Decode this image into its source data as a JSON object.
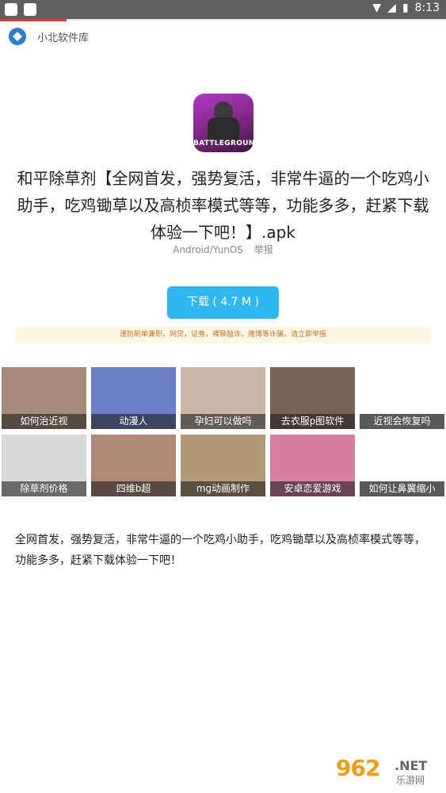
{
  "status_bar": {
    "time": "8:13"
  },
  "progress": {
    "fraction": 0.15
  },
  "app_bar": {
    "title": "小北软件库"
  },
  "app_icon": {
    "brand_text": "BATTLEGROUNDS"
  },
  "app": {
    "title": "和平除草剂【全网首发，强势复活，非常牛逼的一个吃鸡小助手，吃鸡锄草以及高桢率模式等等，功能多多，赶紧下载体验一下吧！】.apk",
    "platform": "Android/YunOS",
    "report_label": "举报",
    "download_label": "下载 ( 4.7 M )",
    "warning_text": "谨防刷单兼职，网贷，证劵，裸聊敲诈，赌博等诈骗，请立即举报"
  },
  "tiles": [
    {
      "label": "如何治近视",
      "color": "#a58a7a"
    },
    {
      "label": "动漫人",
      "color": "#6b7fc6"
    },
    {
      "label": "孕妇可以做吗",
      "color": "#c9b7aa"
    },
    {
      "label": "去衣服p图软件",
      "color": "#7a6258"
    },
    {
      "label": "近视会恢复吗",
      "color": "#ffffff"
    },
    {
      "label": "除草剂价格",
      "color": "#d9d9d9"
    },
    {
      "label": "四维b超",
      "color": "#b08a78"
    },
    {
      "label": "mg动画制作",
      "color": "#b39a78"
    },
    {
      "label": "安卓恋爱游戏",
      "color": "#d97fa2"
    },
    {
      "label": "如何让鼻翼缩小",
      "color": "#ffffff"
    }
  ],
  "description": "全网首发，强势复活，非常牛逼的一个吃鸡小助手，吃鸡锄草以及高桢率模式等等，功能多多，赶紧下载体验一下吧！",
  "watermark": {
    "logo": "962",
    "net": ".NET",
    "sub": "乐游网"
  }
}
